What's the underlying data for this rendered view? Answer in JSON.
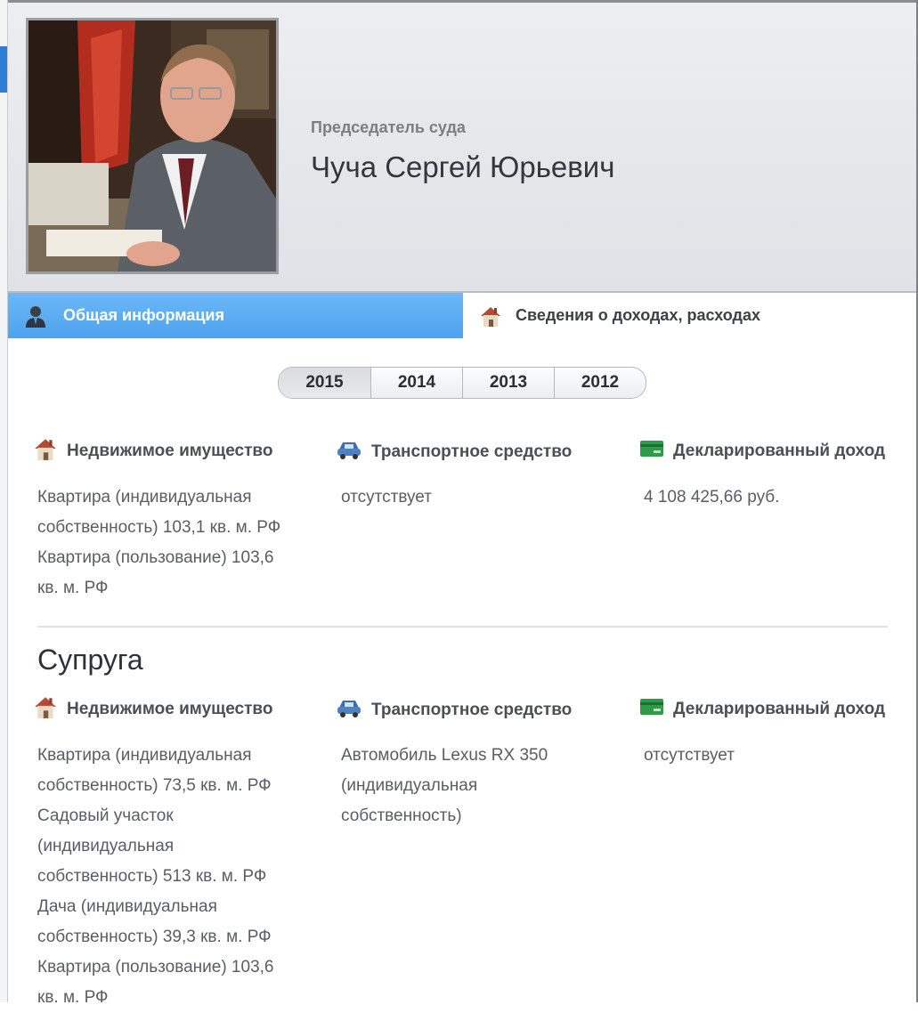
{
  "header": {
    "position": "Председатель суда",
    "name": "Чуча Сергей Юрьевич"
  },
  "tabs": [
    {
      "label": "Общая информация",
      "active": true,
      "icon": "person-icon"
    },
    {
      "label": "Сведения о доходах, расходах",
      "active": false,
      "icon": "house-icon"
    }
  ],
  "years": [
    "2015",
    "2014",
    "2013",
    "2012"
  ],
  "selected_year": "2015",
  "categories": {
    "realty": "Недвижимое имущество",
    "vehicle": "Транспортное средство",
    "income": "Декларированный доход"
  },
  "main": {
    "realty": [
      "Квартира (индивидуальная",
      "собственность) 103,1 кв. м. РФ",
      "Квартира (пользование) 103,6",
      "кв. м. РФ"
    ],
    "vehicle": [
      "отсутствует"
    ],
    "income": [
      "4 108 425,66 руб."
    ]
  },
  "spouse": {
    "title": "Супруга",
    "realty": [
      "Квартира (индивидуальная",
      "собственность) 73,5 кв. м. РФ",
      "Садовый участок",
      "(индивидуальная",
      "собственность) 513 кв. м. РФ",
      "Дача (индивидуальная",
      "собственность) 39,3 кв. м. РФ",
      "Квартира (пользование) 103,6",
      "кв. м. РФ"
    ],
    "vehicle": [
      "Автомобиль Lexus RX 350",
      "(индивидуальная",
      "собственность)"
    ],
    "income": [
      "отсутствует"
    ]
  },
  "colors": {
    "active_tab": "#58aaf2",
    "header_bg": "#e6e8eb"
  }
}
